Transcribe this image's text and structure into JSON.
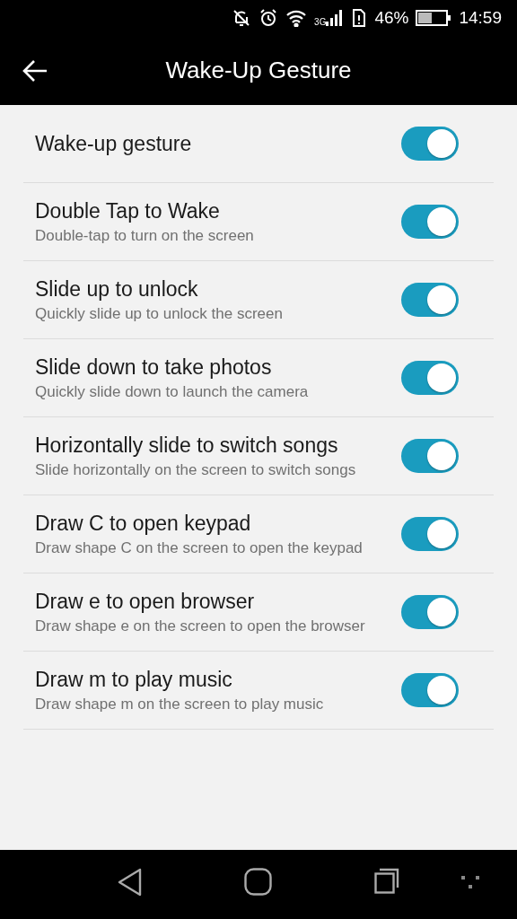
{
  "status_bar": {
    "network": "3G",
    "battery": "46%",
    "time": "14:59"
  },
  "header": {
    "title": "Wake-Up Gesture"
  },
  "settings": [
    {
      "title": "Wake-up gesture",
      "on": true
    },
    {
      "title": "Double Tap to Wake",
      "subtitle": "Double-tap to turn on the screen",
      "on": true
    },
    {
      "title": "Slide up to unlock",
      "subtitle": "Quickly slide up to unlock the screen",
      "on": true
    },
    {
      "title": "Slide down to take photos",
      "subtitle": "Quickly slide down to launch the camera",
      "on": true
    },
    {
      "title": "Horizontally slide to switch songs",
      "subtitle": "Slide horizontally on the screen to switch songs",
      "on": true
    },
    {
      "title": "Draw C to open keypad",
      "subtitle": "Draw shape C on the screen to open the keypad",
      "on": true
    },
    {
      "title": "Draw e to open browser",
      "subtitle": "Draw shape e on the screen to open the browser",
      "on": true
    },
    {
      "title": "Draw m to play music",
      "subtitle": "Draw shape m on the screen to play music",
      "on": true
    }
  ]
}
